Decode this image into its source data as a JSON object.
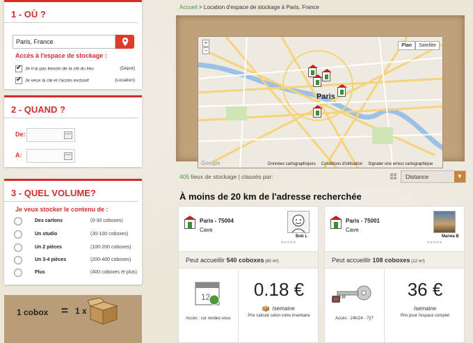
{
  "sidebar": {
    "where": {
      "title": "1 - OÙ ?",
      "location_value": "Paris, France",
      "access_title": "Accès à l'espace de stockage :",
      "options": [
        {
          "label": "Je n'ai pas besoin de la clé du lieu",
          "mode": "(Dépot)"
        },
        {
          "label": "Je veux la clé et l'accès exclusif",
          "mode": "(Location)"
        }
      ]
    },
    "when": {
      "title": "2 - QUAND ?",
      "from_label": "De:",
      "to_label": "A:"
    },
    "volume": {
      "title": "3 - QUEL VOLUME?",
      "question": "Je veux stocker le contenu de :",
      "options": [
        {
          "name": "Des cartons",
          "range": "(0-30 coboxes)"
        },
        {
          "name": "Un studio",
          "range": "(30-100 coboxes)"
        },
        {
          "name": "Un 2 pièces",
          "range": "(100-200 coboxes)"
        },
        {
          "name": "Un 3-4 pièces",
          "range": "(200-400 coboxes)"
        },
        {
          "name": "Plus",
          "range": "(400 coboxes et plus)"
        }
      ]
    },
    "cobox": {
      "left": "1 cobox",
      "eq": "=",
      "right": "1 x"
    }
  },
  "breadcrumb": {
    "home": "Accueil",
    "rest": " > Location d'espace de stockage à Paris, France"
  },
  "map": {
    "type_buttons": [
      "Plan",
      "Satellite"
    ],
    "city_label": "Paris",
    "footer": [
      "Données cartographiques",
      "Conditions d'utilisation",
      "Signaler une erreur cartographique"
    ],
    "google": "Google"
  },
  "results": {
    "count": "405",
    "count_text": " lieux de stockage | classés par:",
    "sort_value": "Distance",
    "section_title": "À moins de 20 km de l'adresse recherchée"
  },
  "cards": [
    {
      "city": "Paris - 75004",
      "type": "Cave",
      "owner": "Bob L",
      "capacity_prefix": "Peut accueillir ",
      "capacity_value": "540 coboxes",
      "capacity_unit": " (60 m³)",
      "price": "0.18 €",
      "per": "/     /semaine",
      "left_note": "Accès : sur rendez-vous",
      "right_note": "Prix calculé selon votre inventaire"
    },
    {
      "city": "Paris - 75001",
      "type": "Cave",
      "owner": "Marwa B",
      "capacity_prefix": "Peut accueillir ",
      "capacity_value": "108 coboxes",
      "capacity_unit": " (12 m³)",
      "price": "36 €",
      "per": "/semaine",
      "left_note": "Accès : 24h/24 - 7j/7",
      "right_note": "Prix pour l'espace complet"
    }
  ],
  "colors": {
    "accent": "#d62b2b",
    "green": "#3a9a3a",
    "brand_orange": "#c8843b"
  }
}
